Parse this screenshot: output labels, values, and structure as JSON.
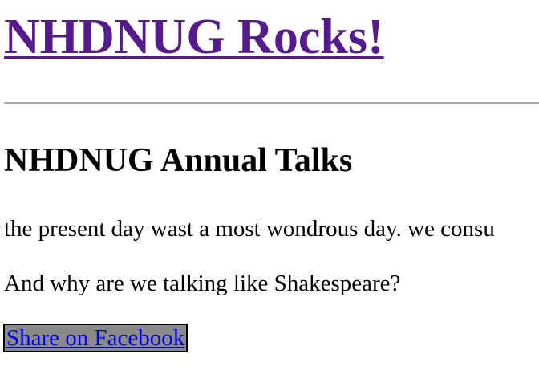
{
  "header": {
    "site_title": "NHDNUG Rocks!"
  },
  "post": {
    "title": "NHDNUG Annual Talks",
    "paragraphs": [
      "the present day wast a most wondrous day. we consu",
      "And why are we talking like Shakespeare?"
    ]
  },
  "share": {
    "label": "Share on Facebook"
  },
  "colors": {
    "visited_link": "#551a8b",
    "link": "#0000ee",
    "divider": "#a8a8a8",
    "share_background": "#8a8a8a"
  }
}
